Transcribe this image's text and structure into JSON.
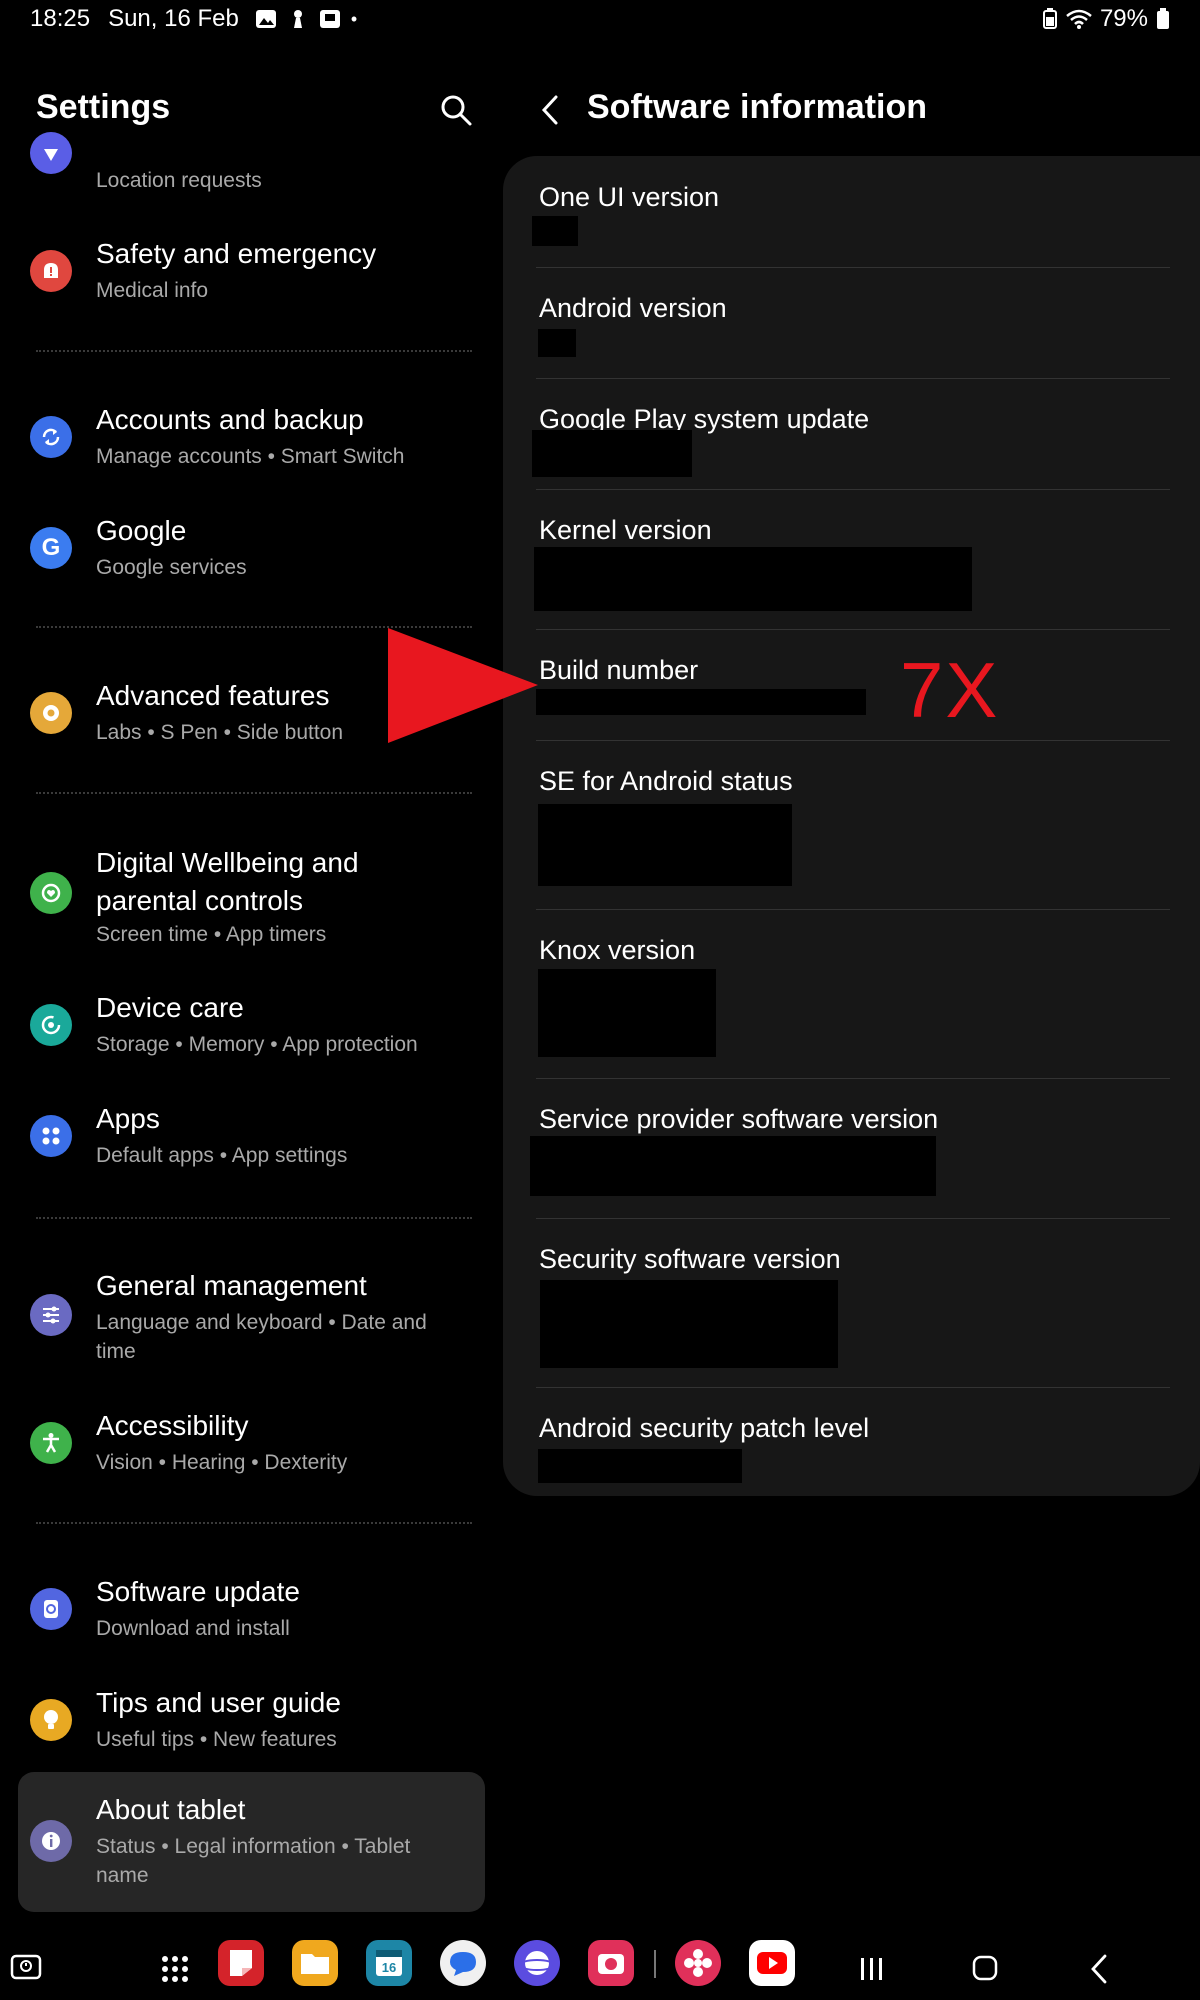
{
  "status_bar": {
    "time": "18:25",
    "date": "Sun, 16 Feb",
    "battery": "79%"
  },
  "left_pane": {
    "title": "Settings",
    "items": [
      {
        "title": "",
        "subtitle": "Location requests",
        "icon": "location-icon",
        "color": "#5a5ee6"
      },
      {
        "title": "Safety and emergency",
        "subtitle": "Medical info",
        "icon": "safety-icon",
        "color": "#e0473f"
      },
      {
        "title": "Accounts and backup",
        "subtitle": "Manage accounts  •  Smart Switch",
        "icon": "sync-icon",
        "color": "#3b6fe8"
      },
      {
        "title": "Google",
        "subtitle": "Google services",
        "icon": "google-icon",
        "color": "#3b7cf0"
      },
      {
        "title": "Advanced features",
        "subtitle": "Labs  •  S Pen  •  Side button",
        "icon": "gear-flower-icon",
        "color": "#e5a839"
      },
      {
        "title": "Digital Wellbeing and parental controls",
        "subtitle": "Screen time  •  App timers",
        "icon": "wellbeing-icon",
        "color": "#3fb24b"
      },
      {
        "title": "Device care",
        "subtitle": "Storage  •  Memory  •  App protection",
        "icon": "device-care-icon",
        "color": "#1aa99a"
      },
      {
        "title": "Apps",
        "subtitle": "Default apps  •  App settings",
        "icon": "apps-icon",
        "color": "#3b6fe8"
      },
      {
        "title": "General management",
        "subtitle": "Language and keyboard  •  Date and time",
        "icon": "sliders-icon",
        "color": "#6a6ac2"
      },
      {
        "title": "Accessibility",
        "subtitle": "Vision  •  Hearing  •  Dexterity",
        "icon": "accessibility-icon",
        "color": "#3fb24b"
      },
      {
        "title": "Software update",
        "subtitle": "Download and install",
        "icon": "software-update-icon",
        "color": "#5266e0"
      },
      {
        "title": "Tips and user guide",
        "subtitle": "Useful tips  •  New features",
        "icon": "bulb-icon",
        "color": "#e8a923"
      },
      {
        "title": "About tablet",
        "subtitle": "Status  •  Legal information  •  Tablet name",
        "icon": "info-icon",
        "color": "#6e6aa8"
      }
    ]
  },
  "right_pane": {
    "title": "Software information",
    "rows": [
      {
        "label": "One UI version"
      },
      {
        "label": "Android version"
      },
      {
        "label": "Google Play system update"
      },
      {
        "label": "Kernel version"
      },
      {
        "label": "Build number"
      },
      {
        "label": "SE for Android status"
      },
      {
        "label": "Knox version"
      },
      {
        "label": "Service provider software version"
      },
      {
        "label": "Security software version"
      },
      {
        "label": "Android security patch level"
      }
    ]
  },
  "annotation": {
    "tap_count": "7X",
    "color": "#e8171f"
  }
}
